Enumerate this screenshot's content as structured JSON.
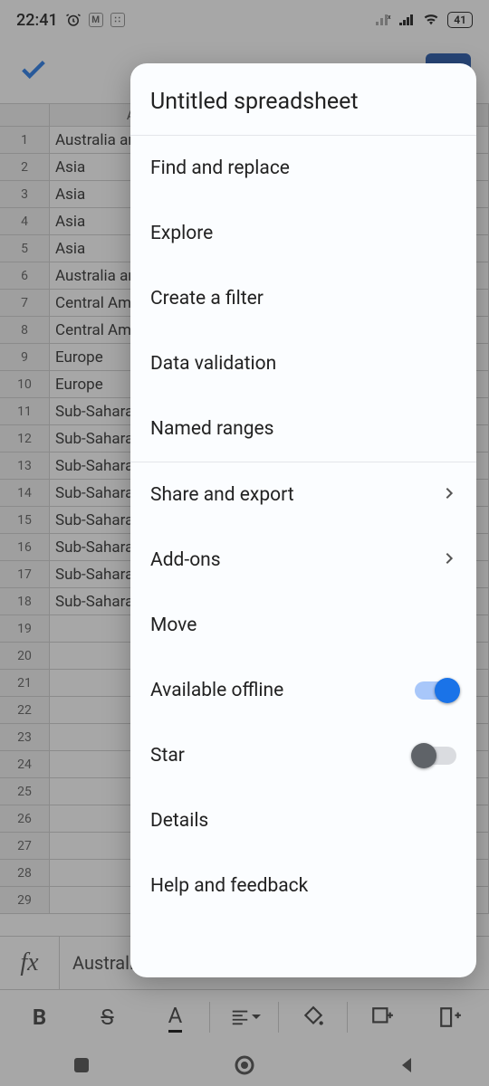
{
  "status": {
    "time": "22:41",
    "battery": "41"
  },
  "sheet": {
    "col_header": "A",
    "rows": [
      "Australia and Oceania",
      "Asia",
      "Asia",
      "Asia",
      "Asia",
      "Australia and Oceania",
      "Central America",
      "Central America",
      "Europe",
      "Europe",
      "Sub-Saharan Africa",
      "Sub-Saharan Africa",
      "Sub-Saharan Africa",
      "Sub-Saharan Africa",
      "Sub-Saharan Africa",
      "Sub-Saharan Africa",
      "Sub-Saharan Africa",
      "Sub-Saharan Africa",
      "",
      "",
      "",
      "",
      "",
      "",
      "",
      "",
      "",
      "",
      ""
    ]
  },
  "formula": {
    "label": "fx",
    "value": "Australia and Oceania"
  },
  "modal": {
    "title": "Untitled spreadsheet",
    "items": {
      "find_replace": "Find and replace",
      "explore": "Explore",
      "create_filter": "Create a filter",
      "data_validation": "Data validation",
      "named_ranges": "Named ranges",
      "share_export": "Share and export",
      "add_ons": "Add-ons",
      "move": "Move",
      "available_offline": "Available offline",
      "star": "Star",
      "details": "Details",
      "help_feedback": "Help and feedback"
    },
    "toggles": {
      "available_offline": true,
      "star": false
    }
  }
}
